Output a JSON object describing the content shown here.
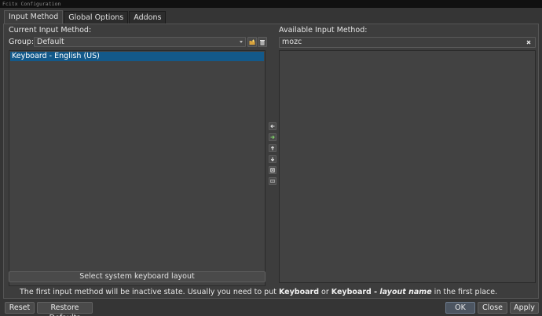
{
  "window": {
    "title": "Fcitx Configuration"
  },
  "tabs": [
    {
      "label": "Input Method",
      "active": true
    },
    {
      "label": "Global Options",
      "active": false
    },
    {
      "label": "Addons",
      "active": false
    }
  ],
  "current": {
    "heading": "Current Input Method:",
    "group_label": "Group:",
    "group_value": "Default",
    "items": [
      "Keyboard - English (US)"
    ],
    "select_layout_button": "Select system keyboard layout"
  },
  "available": {
    "heading": "Available Input Method:",
    "search_value": "mozc",
    "items": []
  },
  "hint": {
    "prefix": "The first input method will be inactive state. Usually you need to put ",
    "bold1": "Keyboard",
    "mid": " or ",
    "bold2": "Keyboard - ",
    "bold_italic": "layout name",
    "suffix": " in the first place."
  },
  "footer": {
    "reset": "Reset",
    "restore": "Restore Defaults",
    "ok": "OK",
    "close": "Close",
    "apply": "Apply"
  },
  "colors": {
    "selection": "#13598a",
    "background": "#3d3d3d",
    "add_arrow": "#7fd06a"
  },
  "icons": {
    "group_add": "folder-plus-icon",
    "group_remove": "delete-icon",
    "remove_im": "arrow-left-icon",
    "add_im": "arrow-right-icon",
    "move_up": "arrow-up-icon",
    "move_down": "arrow-down-icon",
    "configure": "settings-icon",
    "keyboard": "keyboard-icon"
  }
}
